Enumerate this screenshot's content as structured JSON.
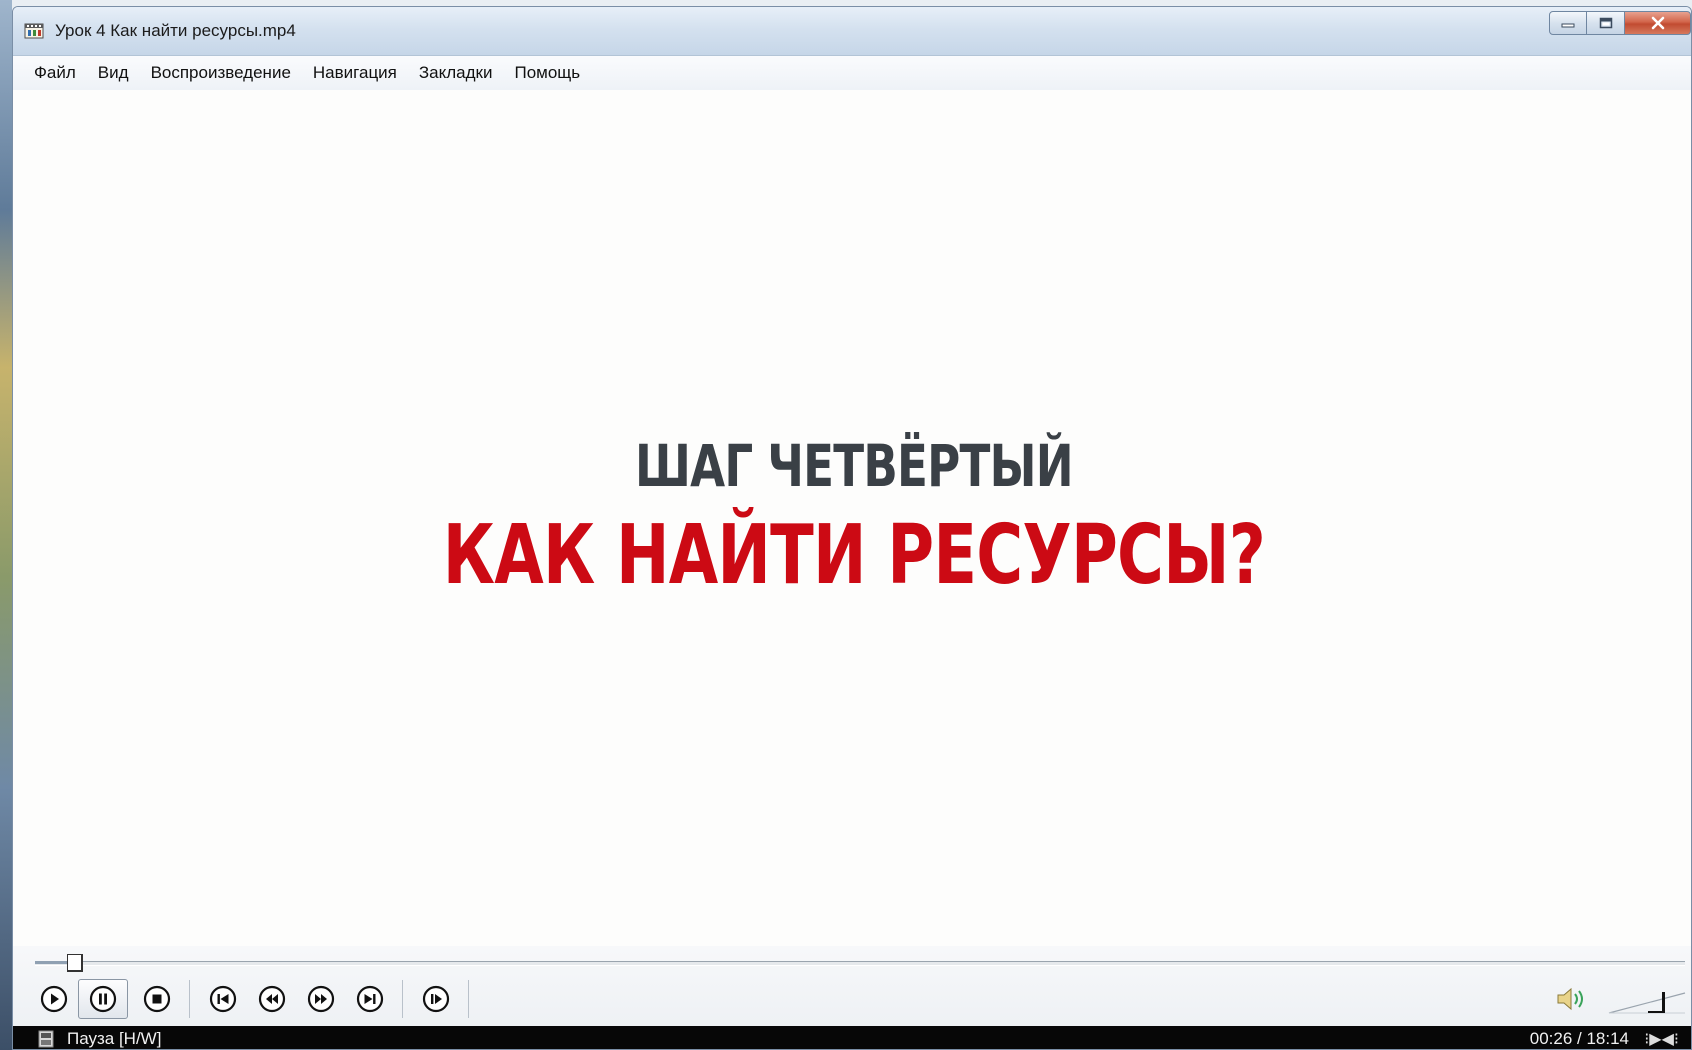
{
  "window": {
    "title": "Урок 4 Как найти ресурсы.mp4"
  },
  "menu": {
    "items": [
      "Файл",
      "Вид",
      "Воспроизведение",
      "Навигация",
      "Закладки",
      "Помощь"
    ]
  },
  "video": {
    "line1": "ШАГ ЧЕТВЁРТЫЙ",
    "line2": "КАК НАЙТИ РЕСУРСЫ?"
  },
  "playback": {
    "position_fraction": 0.024,
    "volume_fraction": 0.7,
    "buttons": [
      "play-icon",
      "pause-icon",
      "stop-icon",
      "previous-icon",
      "rewind-icon",
      "fast-forward-icon",
      "next-icon",
      "frame-step-icon"
    ]
  },
  "status": {
    "state": "Пауза [H/W]",
    "time": "00:26 / 18:14"
  },
  "colors": {
    "slide_line1": "#3a4046",
    "slide_line2": "#cc0a14",
    "statusbar": "#070707"
  }
}
